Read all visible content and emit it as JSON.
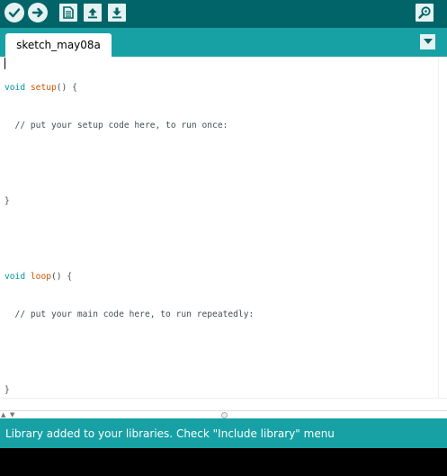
{
  "toolbar": {
    "buttons": [
      {
        "icon": "verify-checkmark-icon"
      },
      {
        "icon": "upload-arrow-icon"
      },
      {
        "icon": "new-sketch-icon"
      },
      {
        "icon": "open-sketch-icon"
      },
      {
        "icon": "save-sketch-icon"
      },
      {
        "icon": "serial-monitor-magnifier-icon"
      }
    ]
  },
  "tabs": [
    {
      "label": "sketch_may08a",
      "active": true
    }
  ],
  "editor": {
    "lines": [
      {
        "kw": "void",
        "fn": "setup",
        "rest": "() {"
      },
      {
        "text": "  // put your setup code here, to run once:"
      },
      {
        "text": ""
      },
      {
        "text": "}"
      },
      {
        "text": ""
      },
      {
        "kw": "void",
        "fn": "loop",
        "rest": "() {"
      },
      {
        "text": "  // put your main code here, to run repeatedly:"
      },
      {
        "text": ""
      },
      {
        "text": "}"
      }
    ]
  },
  "status": {
    "message": "Library added to your libraries. Check \"Include library\" menu"
  },
  "colors": {
    "toolbar_bg": "#006468",
    "tabbar_bg": "#17a1a5",
    "status_bg": "#17a1a5",
    "keyword": "#00979c",
    "function": "#d35400",
    "console_bg": "#000000"
  }
}
